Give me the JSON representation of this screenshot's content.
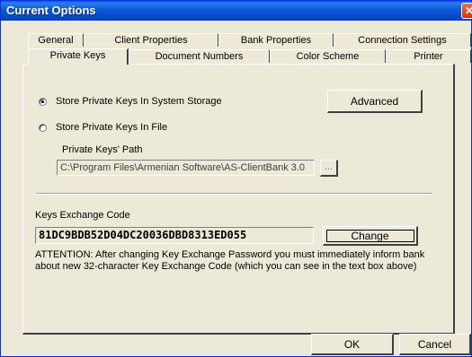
{
  "window": {
    "title": "Current Options",
    "close_glyph": "✕"
  },
  "tabs_row1": [
    "General",
    "Client Properties",
    "Bank Properties",
    "Connection Settings"
  ],
  "tabs_row2": [
    "Private Keys",
    "Document Numbers",
    "Color Scheme",
    "Printer"
  ],
  "active_tab": "Private Keys",
  "storage": {
    "option_system": "Store Private Keys In System Storage",
    "option_file": "Store Private Keys In File",
    "selected": "system",
    "advanced_label": "Advanced",
    "path_label": "Private Keys' Path",
    "path_value": "C:\\Program Files\\Armenian Software\\AS-ClientBank 3.0",
    "browse_label": "..."
  },
  "keys": {
    "exchange_label": "Keys Exchange Code",
    "exchange_code": "81DC9BDB52D04DC20036DBD8313ED055",
    "change_label": "Change",
    "attention_line1": "ATTENTION: After changing Key Exchange Password you must immediately inform bank",
    "attention_line2": "about new 32-character Key Exchange Code (which you can see in the text box above)"
  },
  "footer": {
    "ok_label": "OK",
    "cancel_label": "Cancel"
  }
}
